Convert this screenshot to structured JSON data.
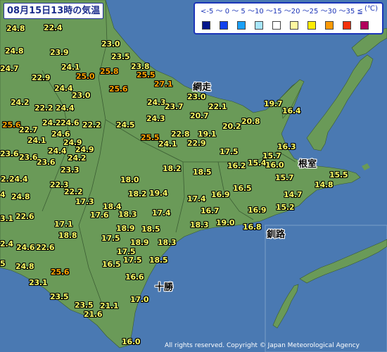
{
  "title": "08月15日13時の気温",
  "copyright": "All rights reserved. Copyright © Japan Meteorological Agency",
  "legend": {
    "ranges": "<-5 ～ 0 ～ 5 ～10 ～15 ～20 ～25 ～30 ～35 ≦",
    "unit": "(℃)",
    "colors": [
      "#05168b",
      "#1242ee",
      "#1aa0f7",
      "#a8e6fc",
      "#ffffff",
      "#fff8a0",
      "#fdec00",
      "#fb9a05",
      "#f4310b",
      "#b2005c"
    ]
  },
  "colors": {
    "sea": "#4a79b2",
    "land": "#6a9a58",
    "temp_normal": "#ffff66",
    "temp_warm": "#ffa500"
  },
  "places": [
    {
      "name": "網走"
    },
    {
      "name": "根室"
    },
    {
      "name": "釧路"
    },
    {
      "name": "十勝"
    }
  ],
  "temps": [
    {
      "value": "24.8",
      "cls": "normal"
    },
    {
      "value": "22.4",
      "cls": "normal"
    },
    {
      "value": "24.8",
      "cls": "normal"
    },
    {
      "value": "23.9",
      "cls": "normal"
    },
    {
      "value": "23.0",
      "cls": "normal"
    },
    {
      "value": "24.7",
      "cls": "normal"
    },
    {
      "value": "23.5",
      "cls": "normal"
    },
    {
      "value": "24.1",
      "cls": "normal"
    },
    {
      "value": "23.8",
      "cls": "normal"
    },
    {
      "value": "25.8",
      "cls": "warm"
    },
    {
      "value": "25.5",
      "cls": "warm"
    },
    {
      "value": "22.9",
      "cls": "normal"
    },
    {
      "value": "25.0",
      "cls": "warm"
    },
    {
      "value": "24.4",
      "cls": "normal"
    },
    {
      "value": "25.6",
      "cls": "warm"
    },
    {
      "value": "27.1",
      "cls": "warm"
    },
    {
      "value": "23.0",
      "cls": "normal"
    },
    {
      "value": "23.0",
      "cls": "normal"
    },
    {
      "value": "24.2",
      "cls": "normal"
    },
    {
      "value": "22.2",
      "cls": "normal"
    },
    {
      "value": "24.4",
      "cls": "normal"
    },
    {
      "value": "24.3",
      "cls": "normal"
    },
    {
      "value": "23.7",
      "cls": "normal"
    },
    {
      "value": "22.1",
      "cls": "normal"
    },
    {
      "value": "19.7",
      "cls": "normal"
    },
    {
      "value": "16.4",
      "cls": "normal"
    },
    {
      "value": "20.7",
      "cls": "normal"
    },
    {
      "value": "25.6",
      "cls": "warm"
    },
    {
      "value": "24.2",
      "cls": "normal"
    },
    {
      "value": "24.6",
      "cls": "normal"
    },
    {
      "value": "22.7",
      "cls": "normal"
    },
    {
      "value": "22.2",
      "cls": "normal"
    },
    {
      "value": "24.5",
      "cls": "normal"
    },
    {
      "value": "24.3",
      "cls": "normal"
    },
    {
      "value": "20.2",
      "cls": "normal"
    },
    {
      "value": "20.8",
      "cls": "normal"
    },
    {
      "value": "24.6",
      "cls": "normal"
    },
    {
      "value": "22.8",
      "cls": "normal"
    },
    {
      "value": "19.1",
      "cls": "normal"
    },
    {
      "value": "24.1",
      "cls": "normal"
    },
    {
      "value": "25.5",
      "cls": "warm"
    },
    {
      "value": "24.1",
      "cls": "normal"
    },
    {
      "value": "22.9",
      "cls": "normal"
    },
    {
      "value": "24.9",
      "cls": "normal"
    },
    {
      "value": "16.3",
      "cls": "normal"
    },
    {
      "value": "23.6",
      "cls": "normal"
    },
    {
      "value": "24.4",
      "cls": "normal"
    },
    {
      "value": "24.9",
      "cls": "normal"
    },
    {
      "value": "17.5",
      "cls": "normal"
    },
    {
      "value": "15.7",
      "cls": "normal"
    },
    {
      "value": "23.6",
      "cls": "normal"
    },
    {
      "value": "24.2",
      "cls": "normal"
    },
    {
      "value": "23.6",
      "cls": "normal"
    },
    {
      "value": "16.2",
      "cls": "normal"
    },
    {
      "value": "15.4",
      "cls": "normal"
    },
    {
      "value": "16.0",
      "cls": "normal"
    },
    {
      "value": "23.3",
      "cls": "normal"
    },
    {
      "value": "18.2",
      "cls": "normal"
    },
    {
      "value": "18.5",
      "cls": "normal"
    },
    {
      "value": "15.5",
      "cls": "normal"
    },
    {
      "value": "2.4",
      "cls": "normal"
    },
    {
      "value": "24.4",
      "cls": "normal"
    },
    {
      "value": "18.0",
      "cls": "normal"
    },
    {
      "value": "15.7",
      "cls": "normal"
    },
    {
      "value": "14.8",
      "cls": "normal"
    },
    {
      "value": "22.3",
      "cls": "normal"
    },
    {
      "value": "16.5",
      "cls": "normal"
    },
    {
      "value": "22.2",
      "cls": "normal"
    },
    {
      "value": "18.2",
      "cls": "normal"
    },
    {
      "value": "19.4",
      "cls": "normal"
    },
    {
      "value": "16.9",
      "cls": "normal"
    },
    {
      "value": "14.7",
      "cls": "normal"
    },
    {
      "value": "4",
      "cls": "normal"
    },
    {
      "value": "24.8",
      "cls": "normal"
    },
    {
      "value": "17.3",
      "cls": "normal"
    },
    {
      "value": "17.4",
      "cls": "normal"
    },
    {
      "value": "18.4",
      "cls": "normal"
    },
    {
      "value": "15.2",
      "cls": "normal"
    },
    {
      "value": "16.7",
      "cls": "normal"
    },
    {
      "value": "16.9",
      "cls": "normal"
    },
    {
      "value": "22.6",
      "cls": "normal"
    },
    {
      "value": "17.6",
      "cls": "normal"
    },
    {
      "value": "18.3",
      "cls": "normal"
    },
    {
      "value": "17.4",
      "cls": "normal"
    },
    {
      "value": "3.1",
      "cls": "normal"
    },
    {
      "value": "17.1",
      "cls": "normal"
    },
    {
      "value": "18.3",
      "cls": "normal"
    },
    {
      "value": "19.0",
      "cls": "normal"
    },
    {
      "value": "16.8",
      "cls": "normal"
    },
    {
      "value": "18.9",
      "cls": "normal"
    },
    {
      "value": "18.5",
      "cls": "normal"
    },
    {
      "value": "18.8",
      "cls": "normal"
    },
    {
      "value": "17.5",
      "cls": "normal"
    },
    {
      "value": "2.4",
      "cls": "normal"
    },
    {
      "value": "18.9",
      "cls": "normal"
    },
    {
      "value": "18.3",
      "cls": "normal"
    },
    {
      "value": "24.6",
      "cls": "normal"
    },
    {
      "value": "22.6",
      "cls": "normal"
    },
    {
      "value": "17.5",
      "cls": "normal"
    },
    {
      "value": "16.5",
      "cls": "normal"
    },
    {
      "value": "17.5",
      "cls": "normal"
    },
    {
      "value": "18.5",
      "cls": "normal"
    },
    {
      "value": "5",
      "cls": "normal"
    },
    {
      "value": "24.8",
      "cls": "normal"
    },
    {
      "value": "25.6",
      "cls": "warm"
    },
    {
      "value": "16.6",
      "cls": "normal"
    },
    {
      "value": "23.1",
      "cls": "normal"
    },
    {
      "value": "23.5",
      "cls": "normal"
    },
    {
      "value": "17.0",
      "cls": "normal"
    },
    {
      "value": "23.5",
      "cls": "normal"
    },
    {
      "value": "21.1",
      "cls": "normal"
    },
    {
      "value": "21.6",
      "cls": "normal"
    },
    {
      "value": "16.0",
      "cls": "normal"
    }
  ]
}
